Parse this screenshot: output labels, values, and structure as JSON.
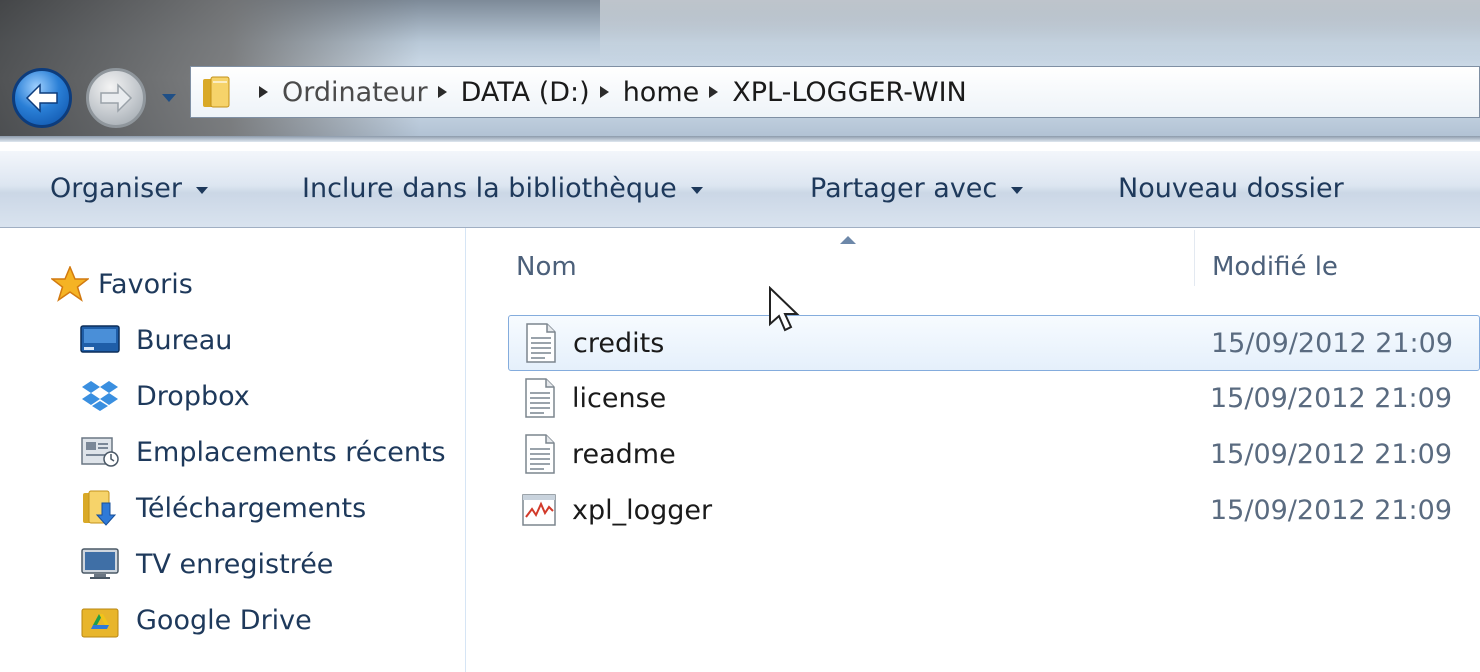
{
  "navigation": {
    "back_icon": "back-arrow-icon",
    "forward_icon": "forward-arrow-icon",
    "history_icon": "chevron-down-icon"
  },
  "address_bar": {
    "breadcrumbs": [
      "Ordinateur",
      "DATA (D:)",
      "home",
      "XPL-LOGGER-WIN"
    ]
  },
  "toolbar": {
    "organize_label": "Organiser",
    "include_label": "Inclure dans la bibliothèque",
    "share_label": "Partager avec",
    "new_folder_label": "Nouveau dossier"
  },
  "sidebar": {
    "favorites_label": "Favoris",
    "items": [
      {
        "label": "Bureau",
        "icon": "desktop-icon"
      },
      {
        "label": "Dropbox",
        "icon": "dropbox-icon"
      },
      {
        "label": "Emplacements récents",
        "icon": "recent-places-icon"
      },
      {
        "label": "Téléchargements",
        "icon": "downloads-icon"
      },
      {
        "label": "TV enregistrée",
        "icon": "tv-icon"
      },
      {
        "label": "Google Drive",
        "icon": "google-drive-icon"
      }
    ]
  },
  "file_list": {
    "columns": {
      "name": "Nom",
      "modified": "Modifié le"
    },
    "rows": [
      {
        "name": "credits",
        "modified": "15/09/2012 21:09",
        "icon": "text-file-icon",
        "selected": true
      },
      {
        "name": "license",
        "modified": "15/09/2012 21:09",
        "icon": "text-file-icon",
        "selected": false
      },
      {
        "name": "readme",
        "modified": "15/09/2012 21:09",
        "icon": "text-file-icon",
        "selected": false
      },
      {
        "name": "xpl_logger",
        "modified": "15/09/2012 21:09",
        "icon": "application-icon",
        "selected": false
      }
    ]
  },
  "colors": {
    "accent": "#1e395b",
    "selection_border": "#84acdd",
    "selection_fill": "#e5f0fb"
  }
}
